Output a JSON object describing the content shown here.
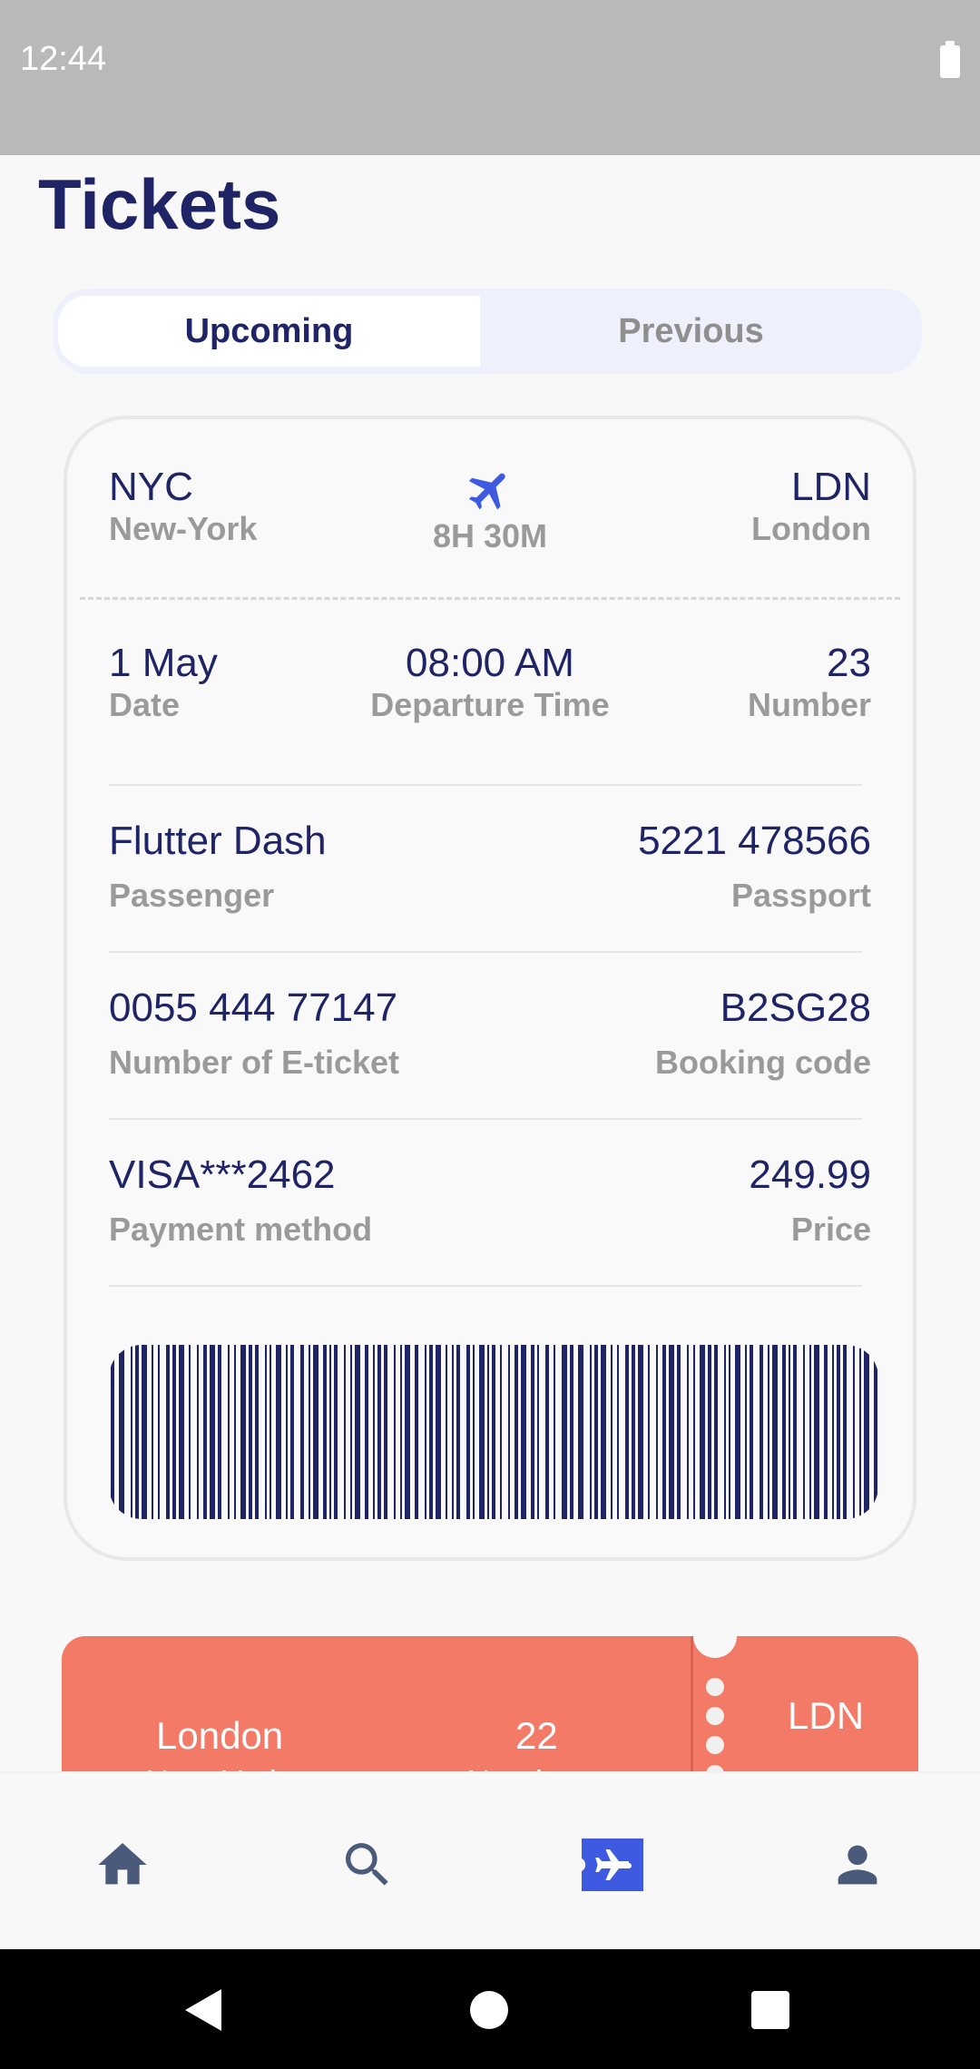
{
  "status_bar": {
    "time": "12:44"
  },
  "page": {
    "title": "Tickets"
  },
  "tabs": [
    {
      "label": "Upcoming",
      "active": true
    },
    {
      "label": "Previous",
      "active": false
    }
  ],
  "ticket": {
    "from_code": "NYC",
    "from_city": "New-York",
    "duration": "8H 30M",
    "to_code": "LDN",
    "to_city": "London",
    "date_value": "1 May",
    "date_label": "Date",
    "time_value": "08:00 AM",
    "time_label": "Departure Time",
    "number_value": "23",
    "number_label": "Number",
    "passenger_value": "Flutter Dash",
    "passenger_label": "Passenger",
    "passport_value": "5221 478566",
    "passport_label": "Passport",
    "eticket_value": "0055 444 77147",
    "eticket_label": "Number of E-ticket",
    "booking_value": "B2SG28",
    "booking_label": "Booking code",
    "payment_value": "VISA***2462",
    "payment_label": "Payment method",
    "price_value": "249.99",
    "price_label": "Price"
  },
  "second_ticket": {
    "from_city": "London",
    "from_city_sub": "New-York",
    "number_value": "22",
    "number_label": "Number",
    "to_code": "LDN"
  },
  "bottom_nav": [
    {
      "icon": "home-icon",
      "active": false
    },
    {
      "icon": "search-icon",
      "active": false
    },
    {
      "icon": "flight-ticket-icon",
      "active": true
    },
    {
      "icon": "person-icon",
      "active": false
    }
  ],
  "colors": {
    "primary_text": "#1f2466",
    "secondary_text": "#9a9a9a",
    "accent_blue": "#3d5ae0",
    "ticket_coral": "#f27a66",
    "nav_icon": "#4a5a7a"
  }
}
